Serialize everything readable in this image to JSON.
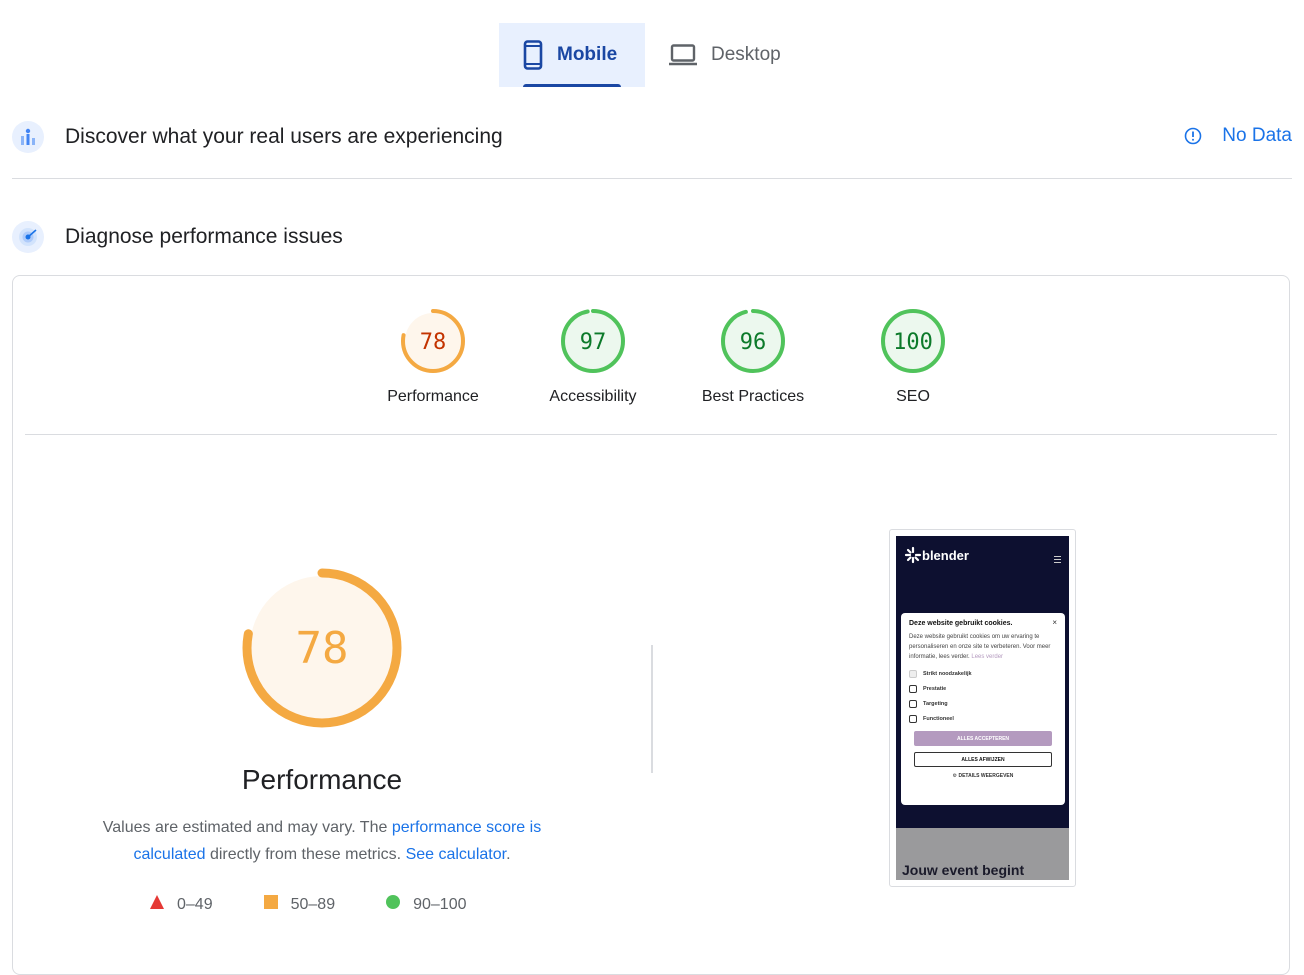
{
  "tabs": [
    {
      "label": "Mobile",
      "active": true,
      "icon": "phone-icon"
    },
    {
      "label": "Desktop",
      "active": false,
      "icon": "laptop-icon"
    }
  ],
  "field_data": {
    "title": "Discover what your real users are experiencing",
    "status": "No Data",
    "icon": "users-chart-icon"
  },
  "lab_data": {
    "title": "Diagnose performance issues",
    "icon": "radar-icon"
  },
  "scores": [
    {
      "label": "Performance",
      "value": "78",
      "rating": "average"
    },
    {
      "label": "Accessibility",
      "value": "97",
      "rating": "good"
    },
    {
      "label": "Best Practices",
      "value": "96",
      "rating": "good"
    },
    {
      "label": "SEO",
      "value": "100",
      "rating": "good"
    }
  ],
  "performance": {
    "score": "78",
    "title": "Performance",
    "desc_prefix": "Values are estimated and may vary. The ",
    "desc_link1": "performance score is calculated",
    "desc_middle": " directly from these metrics. ",
    "desc_link2": "See calculator",
    "desc_suffix": "."
  },
  "legend": [
    {
      "range": "0–49",
      "shape": "triangle",
      "color": "#e53935"
    },
    {
      "range": "50–89",
      "shape": "square",
      "color": "#f4a942"
    },
    {
      "range": "90–100",
      "shape": "circle",
      "color": "#50c35b"
    }
  ],
  "colors": {
    "good": "#0c7a2a",
    "good_ring": "#50c35b",
    "average": "#c33300",
    "average_ring": "#f4a942",
    "accent": "#1a73e8"
  },
  "thumbnail": {
    "brand": "blender",
    "cookie_title": "Deze website gebruikt cookies.",
    "cookie_text": "Deze website gebruikt cookies om uw ervaring te personaliseren en onze site te verbeteren. Voor meer informatie, lees verder.",
    "cookie_more": "Lees verder",
    "options": [
      "Strikt noodzakelijk",
      "Prestatie",
      "Targeting",
      "Functioneel"
    ],
    "accept": "ALLES ACCEPTEREN",
    "reject": "ALLES AFWIJZEN",
    "details": "DETAILS WEERGEVEN",
    "headline": "Jouw event begint"
  }
}
